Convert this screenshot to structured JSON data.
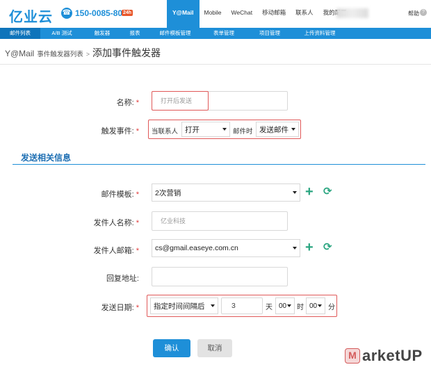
{
  "header": {
    "logo": "亿业云",
    "phone": "150-0085-8090",
    "phone_badge": "24h",
    "nav": [
      "Y@Mail",
      "Mobile",
      "WeChat",
      "移动邮箱",
      "联系人",
      "我的配置"
    ],
    "help": "帮助"
  },
  "menu": [
    "邮件列表",
    "A/B 测试",
    "触发器",
    "报表",
    "邮件模板管理",
    "表单管理",
    "项目管理",
    "上传资料管理"
  ],
  "breadcrumb": {
    "root": "Y@Mail",
    "parent": "事件触发器列表",
    "sep": ">",
    "current": "添加事件触发器"
  },
  "form": {
    "name_label": "名称:",
    "name_placeholder": "打开后发送",
    "trigger_label": "触发事件:",
    "trigger_prefix": "当联系人",
    "trigger_action": "打开",
    "trigger_mid": "邮件时",
    "trigger_result": "发送邮件",
    "required_mark": "*"
  },
  "section": {
    "title": "发送相关信息"
  },
  "send": {
    "template_label": "邮件模板:",
    "template_value": "2次营销",
    "sender_name_label": "发件人名称:",
    "sender_name_placeholder": "亿业科技",
    "sender_email_label": "发件人邮箱:",
    "sender_email_value": "cs@gmail.easeye.com.cn",
    "reply_label": "回复地址:",
    "reply_value": "",
    "date_label": "发送日期:",
    "date_mode": "指定时间间隔后",
    "date_value": "3",
    "day_unit": "天",
    "hour_value": "00",
    "hour_unit": "时",
    "minute_value": "00",
    "minute_unit": "分"
  },
  "buttons": {
    "ok": "确认",
    "cancel": "取消"
  },
  "watermark": {
    "icon": "M",
    "text": "arketUP"
  },
  "colors": {
    "accent": "#1e8fd8",
    "required": "#e03b3b",
    "highlight_border": "#e05858",
    "add_icon": "#2aa580"
  }
}
